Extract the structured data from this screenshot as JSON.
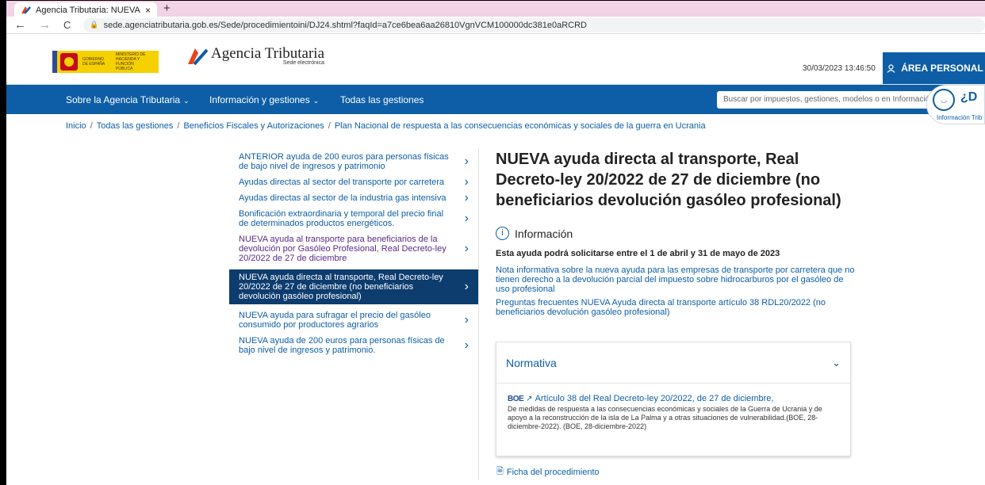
{
  "browser": {
    "tab_title": "Agencia Tributaria: NUEVA ayuda",
    "tab_close": "×",
    "new_tab": "+",
    "back": "←",
    "forward": "→",
    "reload": "C",
    "url": "sede.agenciatributaria.gob.es/Sede/procedimientoini/DJ24.shtml?faqId=a7ce6bea6aa26810VgnVCM100000dc381e0aRCRD"
  },
  "header": {
    "gov_text": "GOBIERNO DE ESPAÑA",
    "ministry_text": "MINISTERIO DE HACIENDA Y FUNCIÓN PÚBLICA",
    "site_title": "Agencia Tributaria",
    "site_subtitle": "Sede electrónica",
    "datetime": "30/03/2023 13:46:50",
    "area_personal": "ÁREA PERSONAL"
  },
  "navbar": {
    "items": [
      {
        "label": "Sobre la Agencia Tributaria",
        "chevron": "⌄"
      },
      {
        "label": "Información y gestiones",
        "chevron": "⌄"
      },
      {
        "label": "Todas las gestiones",
        "chevron": ""
      }
    ],
    "search_placeholder": "Buscar por impuestos, gestiones, modelos o en Información y"
  },
  "chatbot": {
    "question": "¿D",
    "label": "Información Trib"
  },
  "breadcrumb": [
    "Inicio",
    "Todas las gestiones",
    "Beneficios Fiscales y Autorizaciones",
    "Plan Nacional de respuesta a las consecuencias económicas y sociales de la guerra en Ucrania"
  ],
  "sidemenu": [
    {
      "label": "ANTERIOR ayuda de 200 euros para personas físicas de bajo nivel de ingresos y patrimonio",
      "state": "normal"
    },
    {
      "label": "Ayudas directas al sector del transporte por carretera",
      "state": "normal"
    },
    {
      "label": "Ayudas directas al sector de la industria gas intensiva",
      "state": "normal"
    },
    {
      "label": "Bonificación extraordinaria y temporal del precio final de determinados productos energéticos.",
      "state": "normal"
    },
    {
      "label": "NUEVA ayuda al transporte para beneficiarios de la devolución por Gasóleo Profesional, Real Decreto-ley 20/2022 de 27 de diciembre",
      "state": "visited"
    },
    {
      "label": "NUEVA ayuda directa al transporte, Real Decreto-ley 20/2022 de 27 de diciembre (no beneficiarios devolución gasóleo profesional)",
      "state": "active"
    },
    {
      "label": "NUEVA ayuda para sufragar el precio del gasóleo consumido por productores agrarios",
      "state": "normal"
    },
    {
      "label": "NUEVA ayuda de 200 euros para personas físicas de bajo nivel de ingresos y patrimonio.",
      "state": "normal"
    }
  ],
  "main": {
    "title": "NUEVA ayuda directa al transporte, Real Decreto-ley 20/2022 de 27 de diciembre (no beneficiarios devolución gasóleo profesional)",
    "info_heading": "Información",
    "info_icon": "i",
    "notice": "Esta ayuda podrá solicitarse entre el 1 de abril y 31 de mayo de 2023",
    "link1": "Nota informativa sobre la nueva ayuda para las empresas de transporte por carretera que no tienen derecho a la devolución parcial del impuesto sobre hidrocarburos por el gasóleo de uso profesional",
    "link2": "Preguntas frecuentes NUEVA Ayuda directa al transporte artículo 38 RDL20/2022 (no beneficiarios devolución gasóleo profesional)"
  },
  "normativa": {
    "heading": "Normativa",
    "chevron": "⌄",
    "boe_badge": "BOE",
    "ext_icon": "↗",
    "law_link": "Artículo 38 del Real Decreto-ley 20/2022, de 27 de diciembre,",
    "law_desc": "De medidas de respuesta a las consecuencias económicas y sociales de la Guerra de Ucrania y de apoyo a la reconstrucción de la isla de La Palma y a otras situaciones de vulnerabilidad.(BOE, 28-diciembre-2022). (BOE, 28-diciembre-2022)"
  },
  "ficha": {
    "icon": "🗎",
    "label": "Ficha del procedimiento"
  },
  "colors": {
    "brand_blue": "#0d5ea6",
    "active_menu": "#0d3c6e",
    "tabbar": "#f3d3e6"
  }
}
